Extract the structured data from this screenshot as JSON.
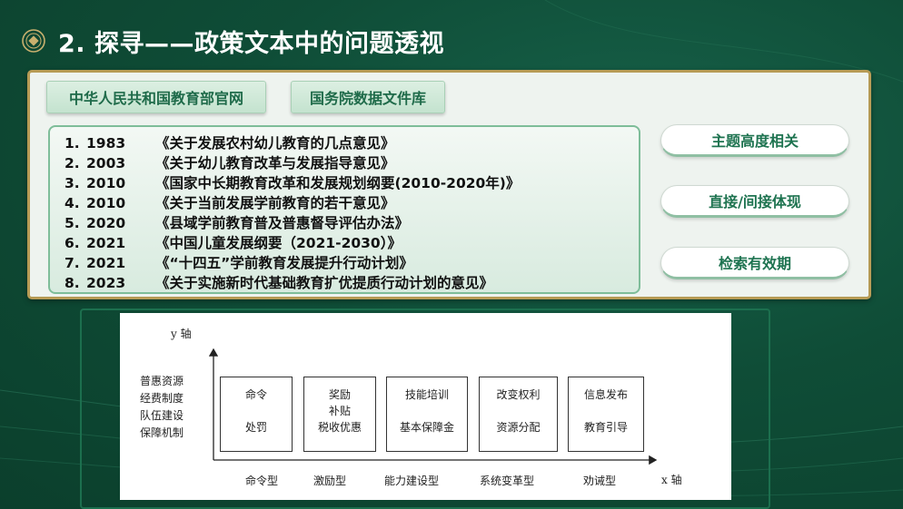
{
  "title": "2. 探寻——政策文本中的问题透视",
  "tabs": [
    {
      "label": "中华人民共和国教育部官网"
    },
    {
      "label": "国务院数据文件库"
    }
  ],
  "policies": [
    {
      "num": "1.",
      "year": "1983",
      "title": "《关于发展农村幼儿教育的几点意见》"
    },
    {
      "num": "2.",
      "year": "2003",
      "title": "《关于幼儿教育改革与发展指导意见》"
    },
    {
      "num": "3.",
      "year": "2010",
      "title": "《国家中长期教育改革和发展规划纲要(2010-2020年)》"
    },
    {
      "num": "4.",
      "year": "2010",
      "title": "《关于当前发展学前教育的若干意见》"
    },
    {
      "num": "5.",
      "year": "2020",
      "title": "《县域学前教育普及普惠督导评估办法》"
    },
    {
      "num": "6.",
      "year": "2021",
      "title": "《中国儿童发展纲要（2021-2030）》"
    },
    {
      "num": "7.",
      "year": "2021",
      "title": "《“十四五”学前教育发展提升行动计划》"
    },
    {
      "num": "8.",
      "year": "2023",
      "title": "《关于实施新时代基础教育扩优提质行动计划的意见》"
    }
  ],
  "criteria": [
    {
      "label": "主题高度相关"
    },
    {
      "label": "直接/间接体现"
    },
    {
      "label": "检索有效期"
    }
  ],
  "diagram": {
    "y_axis_label": "y 轴",
    "x_axis_label": "x 轴",
    "y_values": [
      "普惠资源",
      "经费制度",
      "队伍建设",
      "保障机制"
    ],
    "boxes": [
      {
        "line1": "命令",
        "line2": "",
        "line3": "处罚"
      },
      {
        "line1": "奖励",
        "line2": "补贴",
        "line3": "税收优惠"
      },
      {
        "line1": "技能培训",
        "line2": "",
        "line3": "基本保障金"
      },
      {
        "line1": "改变权利",
        "line2": "",
        "line3": "资源分配"
      },
      {
        "line1": "信息发布",
        "line2": "",
        "line3": "教育引导"
      }
    ],
    "categories": [
      "命令型",
      "激励型",
      "能力建设型",
      "系统变革型",
      "劝诫型"
    ]
  },
  "colors": {
    "background": "#0f4d37",
    "accent_gold": "#b79b55",
    "accent_green": "#1e7350"
  }
}
